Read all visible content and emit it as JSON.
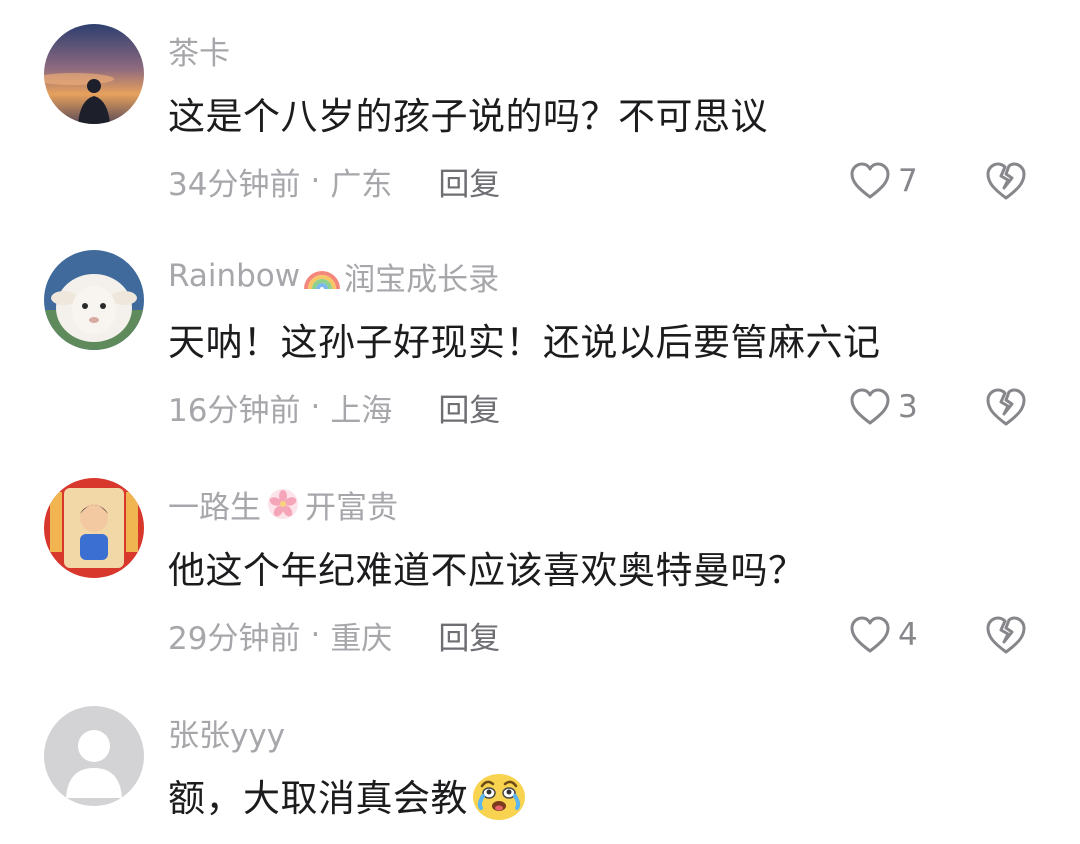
{
  "comments": [
    {
      "username": "茶卡",
      "text": "这是个八岁的孩子说的吗？不可思议",
      "time": "34分钟前",
      "location": "广东",
      "reply_label": "回复",
      "likes": "7",
      "avatar_icon": "sunset-silhouette-avatar"
    },
    {
      "username_prefix": "Rainbow",
      "username_emoji": "rainbow-icon",
      "username_suffix": "润宝成长录",
      "text": "天呐！这孙子好现实！还说以后要管麻六记",
      "time": "16分钟前",
      "location": "上海",
      "reply_label": "回复",
      "likes": "3",
      "avatar_icon": "sheep-avatar"
    },
    {
      "username_prefix": "一路生",
      "username_emoji": "flower-icon",
      "username_suffix": "开富贵",
      "text": "他这个年纪难道不应该喜欢奥特曼吗？",
      "time": "29分钟前",
      "location": "重庆",
      "reply_label": "回复",
      "likes": "4",
      "avatar_icon": "festive-cartoon-avatar"
    },
    {
      "username": "张张yyy",
      "text": "额，大取消真会教",
      "text_emoji": "crying-laughing-face-icon",
      "avatar_icon": "default-user-avatar"
    }
  ],
  "dot_separator": "·",
  "colors": {
    "meta_gray": "#a7a7ab",
    "text_dark": "#1c1c1e",
    "icon_gray": "#86868b"
  }
}
